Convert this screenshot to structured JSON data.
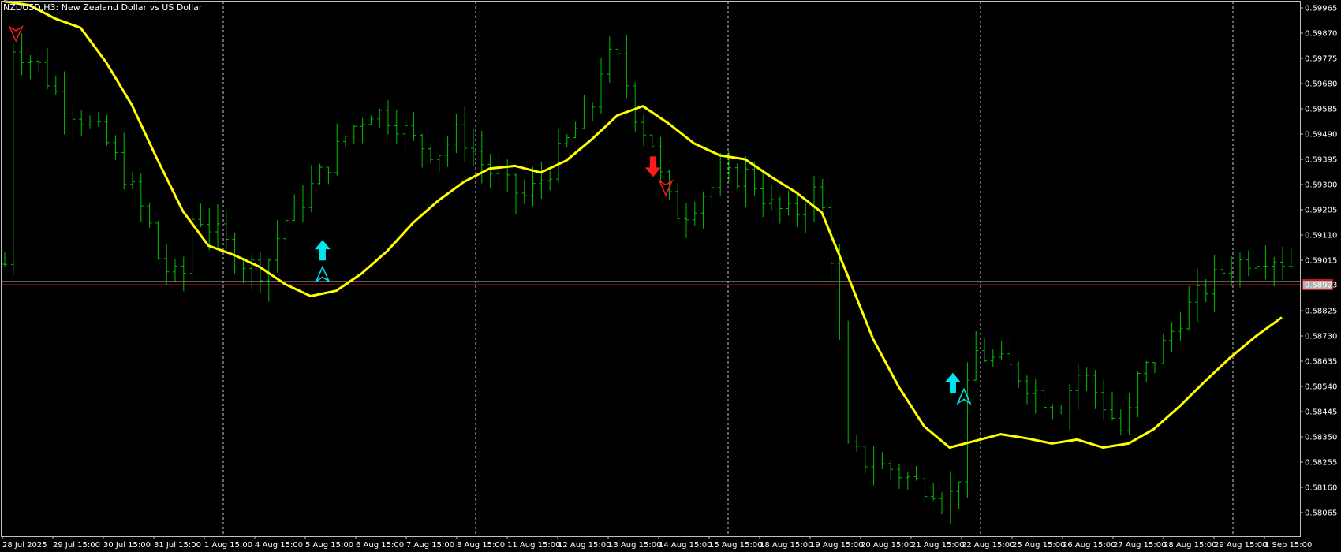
{
  "header": {
    "symbol": "NZDUSD,H3",
    "description": "New Zealand Dollar vs US Dollar"
  },
  "colors": {
    "background": "#000000",
    "frame": "#c0c0c0",
    "bars": "#00c000",
    "moving_average": "#ffff00",
    "separators": "#c8c8c8",
    "bid_line": "#d01010",
    "ask_line": "#b8b8b8",
    "buy_arrow": "#00e5ee",
    "sell_arrow": "#ff1a1a",
    "axis_text": "#ffffff"
  },
  "chart_data": {
    "type": "bar",
    "symbol": "NZDUSD",
    "timeframe": "H3",
    "title": "NZDUSD,H3:  New Zealand Dollar vs US Dollar",
    "y_axis_position": "right",
    "ylim": [
      0.58,
      0.59965
    ],
    "y_ticks": [
      "0.59965",
      "0.59870",
      "0.59775",
      "0.59680",
      "0.59585",
      "0.59490",
      "0.59395",
      "0.59300",
      "0.59205",
      "0.59110",
      "0.59015",
      "0.58825",
      "0.58730",
      "0.58635",
      "0.58540",
      "0.58445",
      "0.58350",
      "0.58255",
      "0.58160",
      "0.58065"
    ],
    "current_price_label": "0.58923",
    "current_price": 0.58923,
    "ask_price": 0.58935,
    "x_ticks": [
      "28 Jul 2025",
      "29 Jul 15:00",
      "30 Jul 15:00",
      "31 Jul 15:00",
      "1 Aug 15:00",
      "4 Aug 15:00",
      "5 Aug 15:00",
      "6 Aug 15:00",
      "7 Aug 15:00",
      "8 Aug 15:00",
      "11 Aug 15:00",
      "12 Aug 15:00",
      "13 Aug 15:00",
      "14 Aug 15:00",
      "15 Aug 15:00",
      "18 Aug 15:00",
      "19 Aug 15:00",
      "20 Aug 15:00",
      "21 Aug 15:00",
      "22 Aug 15:00",
      "25 Aug 15:00",
      "26 Aug 15:00",
      "27 Aug 15:00",
      "28 Aug 15:00",
      "29 Aug 15:00",
      "1 Sep 15:00"
    ],
    "period_separators_after": [
      "1 Aug 15:00",
      "8 Aug 15:00",
      "15 Aug 15:00",
      "22 Aug 15:00",
      "29 Aug 15:00"
    ],
    "price_path": [
      [
        0.5,
        0.5983
      ],
      [
        3,
        0.5975
      ],
      [
        5,
        0.5962
      ],
      [
        7,
        0.5955
      ],
      [
        9,
        0.5947
      ],
      [
        11,
        0.5932
      ],
      [
        13,
        0.5915
      ],
      [
        14,
        0.59
      ],
      [
        16,
        0.5893
      ],
      [
        17,
        0.592
      ],
      [
        19,
        0.5912
      ],
      [
        21,
        0.5902
      ],
      [
        23,
        0.5898
      ],
      [
        24,
        0.5903
      ],
      [
        25,
        0.5915
      ],
      [
        27,
        0.5925
      ],
      [
        29,
        0.5937
      ],
      [
        31,
        0.595
      ],
      [
        33,
        0.5958
      ],
      [
        35,
        0.5955
      ],
      [
        37,
        0.5946
      ],
      [
        39,
        0.5942
      ],
      [
        41,
        0.595
      ],
      [
        43,
        0.5938
      ],
      [
        45,
        0.593
      ],
      [
        47,
        0.5925
      ],
      [
        49,
        0.5935
      ],
      [
        51,
        0.5948
      ],
      [
        53,
        0.596
      ],
      [
        54,
        0.5978
      ],
      [
        55.5,
        0.5976
      ],
      [
        57,
        0.5955
      ],
      [
        58.5,
        0.5945
      ],
      [
        59.5,
        0.5926
      ],
      [
        61,
        0.5918
      ],
      [
        63,
        0.5927
      ],
      [
        65,
        0.5932
      ],
      [
        67,
        0.5934
      ],
      [
        69,
        0.5922
      ],
      [
        71,
        0.5918
      ],
      [
        73,
        0.5927
      ],
      [
        74,
        0.5918
      ],
      [
        75,
        0.589
      ],
      [
        76,
        0.583
      ],
      [
        78,
        0.5825
      ],
      [
        80,
        0.5823
      ],
      [
        82,
        0.5818
      ],
      [
        84,
        0.5816
      ],
      [
        85,
        0.581
      ],
      [
        86.5,
        0.5826
      ],
      [
        87,
        0.5868
      ],
      [
        89,
        0.5864
      ],
      [
        91,
        0.586
      ],
      [
        93,
        0.5852
      ],
      [
        95,
        0.5846
      ],
      [
        97,
        0.586
      ],
      [
        99,
        0.5848
      ],
      [
        101,
        0.5835
      ],
      [
        102,
        0.5856
      ],
      [
        104,
        0.5866
      ],
      [
        106,
        0.588
      ],
      [
        108,
        0.589
      ],
      [
        110,
        0.5898
      ],
      [
        112,
        0.5902
      ],
      [
        114,
        0.5904
      ],
      [
        116,
        0.59
      ]
    ],
    "series": [
      {
        "type": "line",
        "points": [
          [
            0,
            0.5999
          ],
          [
            3,
            0.59975
          ],
          [
            6,
            0.59925
          ],
          [
            9,
            0.5989
          ],
          [
            12,
            0.5976
          ],
          [
            15,
            0.596
          ],
          [
            18,
            0.59395
          ],
          [
            21,
            0.592
          ],
          [
            24,
            0.5907
          ],
          [
            27,
            0.59035
          ],
          [
            30,
            0.5899
          ],
          [
            33,
            0.58925
          ],
          [
            36,
            0.5888
          ],
          [
            39,
            0.589
          ],
          [
            42,
            0.58965
          ],
          [
            45,
            0.5905
          ],
          [
            48,
            0.59155
          ],
          [
            51,
            0.5924
          ],
          [
            54,
            0.5931
          ],
          [
            57,
            0.5936
          ],
          [
            60,
            0.5937
          ],
          [
            63,
            0.59345
          ],
          [
            66,
            0.5939
          ],
          [
            69,
            0.5947
          ],
          [
            72,
            0.5956
          ],
          [
            75,
            0.59595
          ],
          [
            78,
            0.5953
          ],
          [
            81,
            0.59455
          ],
          [
            84,
            0.5941
          ],
          [
            87,
            0.59395
          ],
          [
            90,
            0.5933
          ],
          [
            93,
            0.5927
          ],
          [
            96,
            0.59195
          ],
          [
            99,
            0.5896
          ],
          [
            102,
            0.5872
          ],
          [
            105,
            0.5854
          ],
          [
            108,
            0.5839
          ],
          [
            111,
            0.5831
          ],
          [
            114,
            0.58335
          ],
          [
            117,
            0.5836
          ],
          [
            120,
            0.58345
          ],
          [
            123,
            0.58325
          ],
          [
            126,
            0.5834
          ],
          [
            129,
            0.5831
          ],
          [
            132,
            0.58325
          ],
          [
            135,
            0.5838
          ],
          [
            138,
            0.58465
          ],
          [
            141,
            0.5856
          ],
          [
            144,
            0.5865
          ],
          [
            147,
            0.5873
          ],
          [
            150,
            0.588
          ]
        ]
      }
    ],
    "signals": [
      {
        "type": "sell",
        "bar": 1.5,
        "price": 0.5987,
        "style": "small"
      },
      {
        "type": "buy",
        "bar": 37.5,
        "price": 0.5905,
        "style": "large"
      },
      {
        "type": "buy",
        "bar": 37.5,
        "price": 0.5896,
        "style": "small"
      },
      {
        "type": "sell",
        "bar": 76.3,
        "price": 0.5937,
        "style": "large"
      },
      {
        "type": "sell",
        "bar": 77.8,
        "price": 0.5929,
        "style": "small"
      },
      {
        "type": "buy",
        "bar": 111.5,
        "price": 0.5855,
        "style": "large"
      },
      {
        "type": "buy",
        "bar": 112.8,
        "price": 0.585,
        "style": "small"
      }
    ],
    "grid": false
  }
}
